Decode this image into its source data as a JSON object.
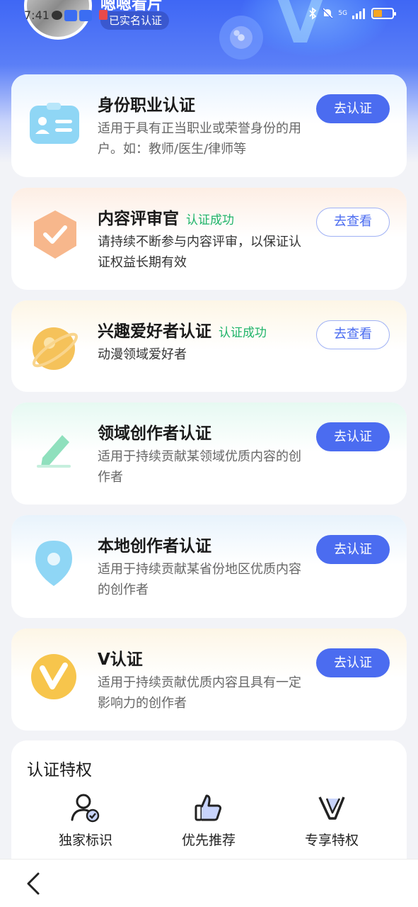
{
  "status_bar": {
    "time": "7:41",
    "signal": "5G",
    "battery_color": "#f5a623"
  },
  "profile": {
    "name": "嗯嗯看片",
    "verified_badge": "已实名认证"
  },
  "cards": [
    {
      "title": "身份职业认证",
      "success": "",
      "desc": "适用于具有正当职业或荣誉身份的用户。如：教师/医生/律师等",
      "button": "去认证",
      "button_style": "primary",
      "icon": "id-card-icon",
      "tint": "#e6f2ff"
    },
    {
      "title": "内容评审官",
      "success": "认证成功",
      "desc": "请持续不断参与内容评审，以保证认证权益长期有效",
      "button": "去查看",
      "button_style": "outline",
      "icon": "reviewer-shield-icon",
      "tint": "#fdeee4"
    },
    {
      "title": "兴趣爱好者认证",
      "success": "认证成功",
      "desc": "动漫领域爱好者",
      "button": "去查看",
      "button_style": "outline",
      "icon": "planet-icon",
      "tint": "#fdf6e6"
    },
    {
      "title": "领域创作者认证",
      "success": "",
      "desc": "适用于持续贡献某领域优质内容的创作者",
      "button": "去认证",
      "button_style": "primary",
      "icon": "pen-icon",
      "tint": "#e6f9f2"
    },
    {
      "title": "本地创作者认证",
      "success": "",
      "desc": "适用于持续贡献某省份地区优质内容的创作者",
      "button": "去认证",
      "button_style": "primary",
      "icon": "location-pin-icon",
      "tint": "#e8f3fc"
    },
    {
      "title": "V认证",
      "success": "",
      "desc": "适用于持续贡献优质内容且具有一定影响力的创作者",
      "button": "去认证",
      "button_style": "primary",
      "icon": "v-badge-icon",
      "tint": "#fdf6e6"
    }
  ],
  "privileges": {
    "title": "认证特权",
    "items": [
      {
        "label": "独家标识",
        "icon": "exclusive-badge-icon"
      },
      {
        "label": "优先推荐",
        "icon": "thumbs-up-icon"
      },
      {
        "label": "专享特权",
        "icon": "v-privilege-icon"
      }
    ]
  },
  "nav": {
    "back_icon": "chevron-left-icon"
  },
  "colors": {
    "primary": "#4b6cf0",
    "success": "#1fb46a",
    "header_blue": "#3f67f5"
  }
}
